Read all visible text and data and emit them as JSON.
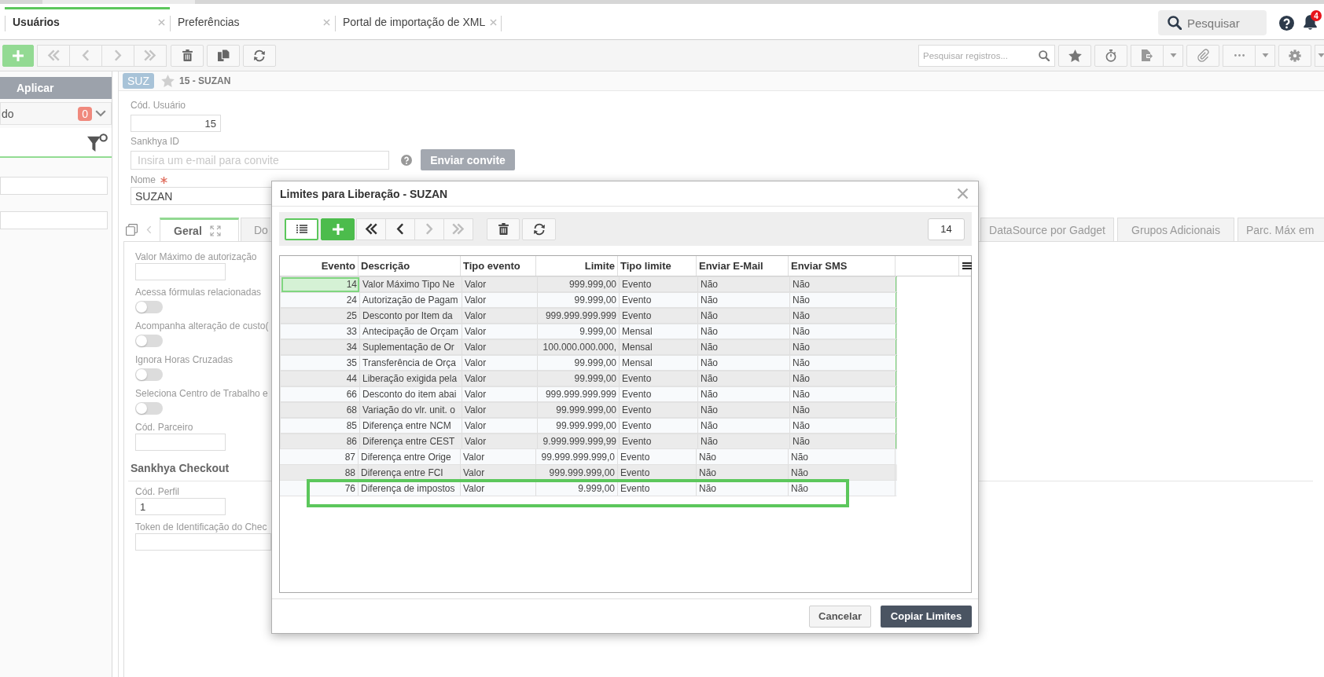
{
  "app_tabs": [
    {
      "label": "Usuários",
      "selected": true
    },
    {
      "label": "Preferências",
      "selected": false
    },
    {
      "label": "Portal de importação de XML",
      "selected": false
    }
  ],
  "global_search": {
    "placeholder": "Pesquisar"
  },
  "notifications": {
    "count": "4"
  },
  "toolbar": {
    "add": {
      "disabled": true
    },
    "navigation": [
      {
        "kind": "first",
        "disabled": true
      },
      {
        "kind": "previous",
        "disabled": true
      },
      {
        "kind": "next",
        "disabled": true
      },
      {
        "kind": "last",
        "disabled": true
      }
    ],
    "record_search": {
      "placeholder": "Pesquisar registros..."
    }
  },
  "filter_panel": {
    "apply_button": "Aplicar",
    "saved_filter": {
      "label": "do",
      "count": "0"
    }
  },
  "record": {
    "badge": "SUZ",
    "starred": false,
    "title": "15 - SUZAN"
  },
  "user_form": {
    "user_code": {
      "label": "Cód. Usuário",
      "value": "15"
    },
    "sankhya_id": {
      "label": "Sankhya ID",
      "placeholder": "Insira um e-mail para convite",
      "invite_button": "Enviar convite"
    },
    "name": {
      "label": "Nome",
      "required": true,
      "value": "SUZAN"
    }
  },
  "form_tabs": {
    "left": [
      {
        "label": "Geral",
        "selected": true
      },
      {
        "label": "Do",
        "selected": false
      }
    ],
    "right": [
      {
        "label": "DataSource por Gadget",
        "selected": false
      },
      {
        "label": "Grupos Adicionais",
        "selected": false
      },
      {
        "label": "Parc. Máx em",
        "selected": false
      }
    ]
  },
  "general_fields": [
    {
      "kind": "number",
      "label": "Valor Máximo de autorização"
    },
    {
      "kind": "toggle",
      "label": "Acessa fórmulas relacionadas",
      "on": false
    },
    {
      "kind": "toggle",
      "label": "Acompanha alteração de custo(",
      "on": false
    },
    {
      "kind": "toggle",
      "label": "Ignora Horas Cruzadas",
      "on": false
    },
    {
      "kind": "toggle",
      "label": "Seleciona Centro de Trabalho e",
      "on": false
    },
    {
      "kind": "number",
      "label": "Cód. Parceiro"
    }
  ],
  "checkout": {
    "title": "Sankhya Checkout",
    "fields": [
      {
        "kind": "number",
        "label": "Cód. Perfil",
        "value": "1"
      },
      {
        "kind": "text",
        "label": "Token de Identificação do Chec"
      }
    ]
  },
  "dialog": {
    "title": "Limites para Liberação - SUZAN",
    "grid_view": {
      "selected": true
    },
    "add": {
      "disabled": false
    },
    "navigation": [
      {
        "kind": "first",
        "disabled": false
      },
      {
        "kind": "previous",
        "disabled": false
      },
      {
        "kind": "next",
        "disabled": true
      },
      {
        "kind": "last",
        "disabled": true
      }
    ],
    "record_count": "14",
    "table": {
      "columns": [
        {
          "label": "Evento",
          "kind": "number"
        },
        {
          "label": "Descrição",
          "kind": "text"
        },
        {
          "label": "Tipo evento",
          "kind": "text"
        },
        {
          "label": "Limite",
          "kind": "number"
        },
        {
          "label": "Tipo limite",
          "kind": "text"
        },
        {
          "label": "Enviar E-Mail",
          "kind": "text"
        },
        {
          "label": "Enviar SMS",
          "kind": "text"
        }
      ],
      "rows": [
        {
          "cells": [
            "14",
            "Valor Máximo Tipo Ne",
            "Valor",
            "999.999,00",
            "Evento",
            "Não",
            "Não"
          ],
          "selected": true,
          "saved": true,
          "highlighted": false
        },
        {
          "cells": [
            "24",
            "Autorização de Pagam",
            "Valor",
            "99.999,00",
            "Evento",
            "Não",
            "Não"
          ],
          "selected": false,
          "saved": true,
          "highlighted": false
        },
        {
          "cells": [
            "25",
            "Desconto por Item da",
            "Valor",
            "999.999.999.999",
            "Evento",
            "Não",
            "Não"
          ],
          "selected": false,
          "saved": true,
          "highlighted": false
        },
        {
          "cells": [
            "33",
            "Antecipação de Orçam",
            "Valor",
            "9.999,00",
            "Mensal",
            "Não",
            "Não"
          ],
          "selected": false,
          "saved": true,
          "highlighted": false
        },
        {
          "cells": [
            "34",
            "Suplementação de Or",
            "Valor",
            "100.000.000.000,",
            "Mensal",
            "Não",
            "Não"
          ],
          "selected": false,
          "saved": true,
          "highlighted": false
        },
        {
          "cells": [
            "35",
            "Transferência de Orça",
            "Valor",
            "99.999,00",
            "Mensal",
            "Não",
            "Não"
          ],
          "selected": false,
          "saved": true,
          "highlighted": false
        },
        {
          "cells": [
            "44",
            "Liberação exigida pela",
            "Valor",
            "99.999,00",
            "Evento",
            "Não",
            "Não"
          ],
          "selected": false,
          "saved": true,
          "highlighted": false
        },
        {
          "cells": [
            "66",
            "Desconto do item abai",
            "Valor",
            "999.999.999.999",
            "Evento",
            "Não",
            "Não"
          ],
          "selected": false,
          "saved": true,
          "highlighted": false
        },
        {
          "cells": [
            "68",
            "Variação do vlr. unit. o",
            "Valor",
            "99.999.999,00",
            "Evento",
            "Não",
            "Não"
          ],
          "selected": false,
          "saved": true,
          "highlighted": false
        },
        {
          "cells": [
            "85",
            "Diferença entre NCM",
            "Valor",
            "99.999.999,00",
            "Evento",
            "Não",
            "Não"
          ],
          "selected": false,
          "saved": true,
          "highlighted": false
        },
        {
          "cells": [
            "86",
            "Diferença entre CEST",
            "Valor",
            "9.999.999.999,99",
            "Evento",
            "Não",
            "Não"
          ],
          "selected": false,
          "saved": true,
          "highlighted": false
        },
        {
          "cells": [
            "87",
            "Diferença entre Orige",
            "Valor",
            "99.999.999.999,0",
            "Evento",
            "Não",
            "Não"
          ],
          "selected": false,
          "saved": false,
          "highlighted": false
        },
        {
          "cells": [
            "88",
            "Diferença entre FCI",
            "Valor",
            "999.999.999,00",
            "Evento",
            "Não",
            "Não"
          ],
          "selected": false,
          "saved": false,
          "highlighted": false
        },
        {
          "cells": [
            "76",
            "Diferença de impostos",
            "Valor",
            "9.999,00",
            "Evento",
            "Não",
            "Não"
          ],
          "selected": false,
          "saved": false,
          "highlighted": true
        }
      ]
    },
    "buttons": [
      {
        "label": "Cancelar",
        "kind": "secondary"
      },
      {
        "label": "Copiar Limites",
        "kind": "primary"
      }
    ]
  }
}
